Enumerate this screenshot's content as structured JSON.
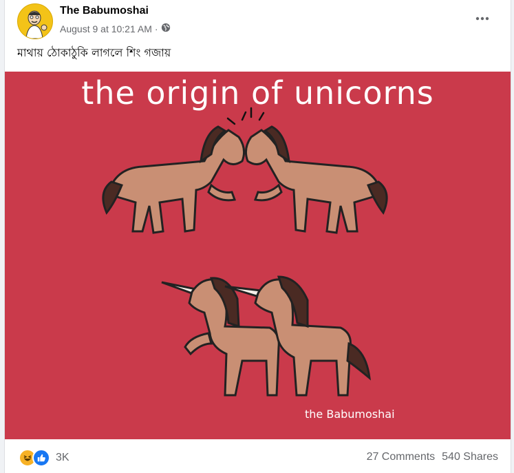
{
  "post": {
    "author": "The Babumoshai",
    "date": "August 9 at 10:21 AM",
    "separator": "·",
    "caption": "মাথায় ঠোকাঠুকি লাগলে শিং গজায়"
  },
  "image": {
    "title": "the origin of unicorns",
    "credit": "the Babumoshai",
    "background_color": "#ca3a4b"
  },
  "stats": {
    "reaction_count": "3K",
    "comments": "27 Comments",
    "shares": "540 Shares"
  },
  "icons": {
    "privacy": "globe-icon",
    "menu": "more-horizontal-icon",
    "reactions": [
      "haha-icon",
      "like-icon"
    ]
  }
}
